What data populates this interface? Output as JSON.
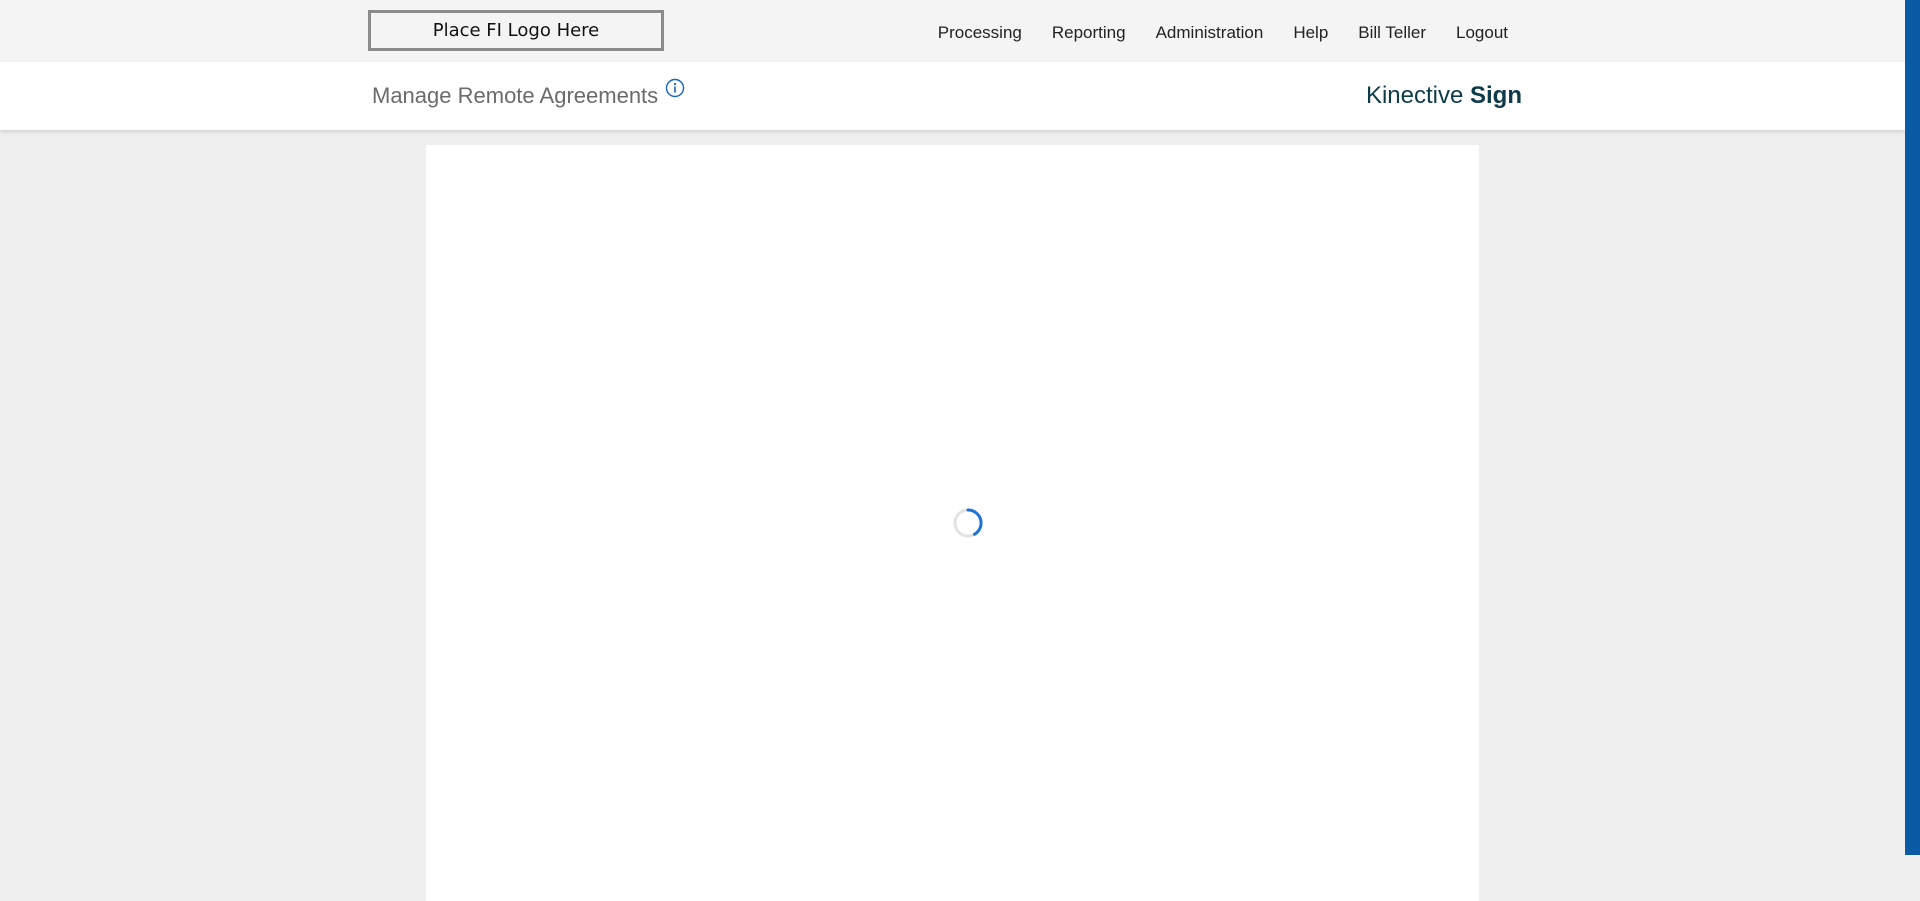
{
  "header": {
    "logo_text": "Place FI Logo Here",
    "nav": [
      {
        "label": "Processing"
      },
      {
        "label": "Reporting"
      },
      {
        "label": "Administration"
      },
      {
        "label": "Help"
      },
      {
        "label": "Bill Teller"
      },
      {
        "label": "Logout"
      }
    ]
  },
  "subheader": {
    "page_title": "Manage Remote Agreements",
    "brand_light": "Kinective ",
    "brand_bold": "Sign"
  },
  "colors": {
    "accent": "#0a5aa5",
    "brand_text": "#0d3b4a",
    "spinner": "#1f74d6"
  },
  "icons": {
    "info": "info-icon",
    "loading": "loading-spinner-icon"
  }
}
